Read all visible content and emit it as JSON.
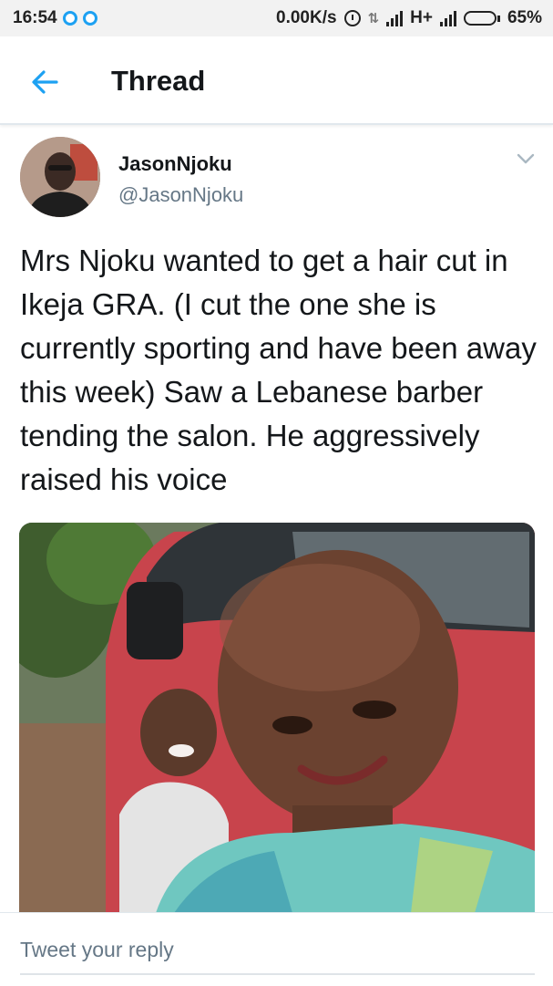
{
  "status_bar": {
    "time": "16:54",
    "net_speed": "0.00K/s",
    "network_type": "H+",
    "battery": "65%",
    "battery_level": 0.65,
    "accent": "#1da1f2"
  },
  "header": {
    "title": "Thread",
    "back_icon": "arrow-left-icon",
    "accent": "#1da1f2"
  },
  "tweet": {
    "display_name": "JasonNjoku",
    "handle": "@JasonNjoku",
    "menu_icon": "chevron-down-icon",
    "text": "Mrs Njoku wanted to get a hair cut in Ikeja GRA. (I cut the one she is currently sporting and have been away this week) Saw a Lebanese barber tending the salon. He aggressively raised his voice"
  },
  "reply": {
    "placeholder": "Tweet your reply"
  }
}
